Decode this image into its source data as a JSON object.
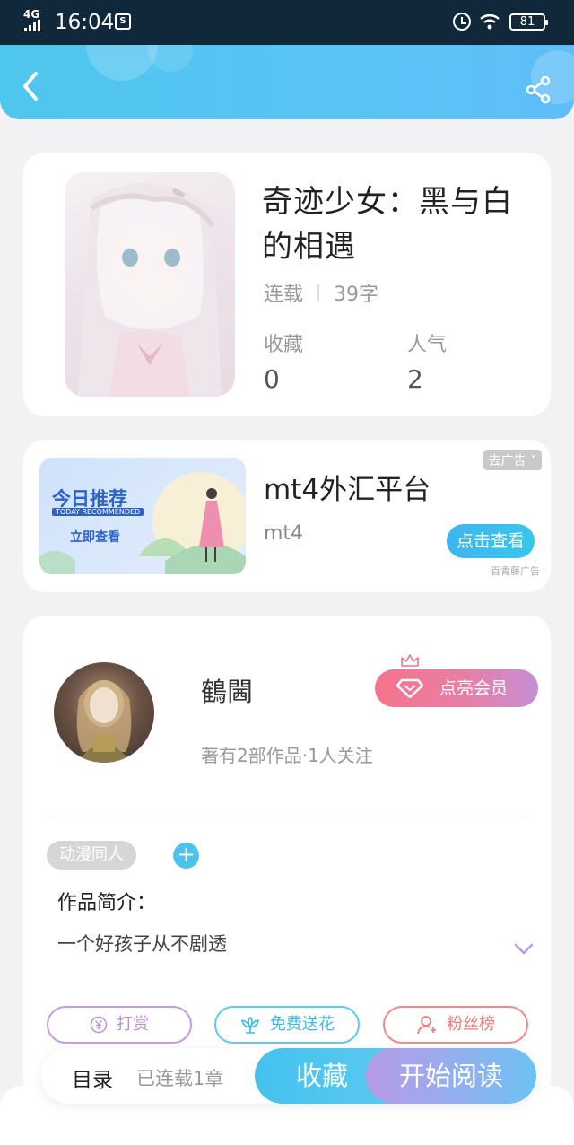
{
  "status_bar": {
    "network": "4G",
    "time": "16:04",
    "extra_icon": "S",
    "battery": "81"
  },
  "header": {
    "back_icon": "chevron-left-icon",
    "share_icon": "share-icon"
  },
  "book": {
    "title": "奇迹少女：黑与白的相遇",
    "status": "连载",
    "word_count": "39字",
    "favorites_label": "收藏",
    "favorites_value": "0",
    "popularity_label": "人气",
    "popularity_value": "2"
  },
  "ad": {
    "remove_label": "去广告",
    "banner_title": "今日推荐",
    "banner_subtitle": "TODAY RECOMMENDED",
    "banner_button": "立即查看",
    "title": "mt4外汇平台",
    "subtitle": "mt4",
    "button": "点击查看",
    "source": "百青藤广告"
  },
  "author": {
    "name": "鶴閪",
    "stats": "著有2部作品·1人关注",
    "vip_button": "点亮会员"
  },
  "tags": [
    "动漫同人"
  ],
  "intro": {
    "label": "作品简介：",
    "text": "一个好孩子从不剧透"
  },
  "actions": [
    {
      "label": "打赏",
      "icon": "yen-icon",
      "color": "#b98ee0"
    },
    {
      "label": "免费送花",
      "icon": "flower-icon",
      "color": "#4fc4ec"
    },
    {
      "label": "粉丝榜",
      "icon": "user-icon",
      "color": "#ee7b7b"
    }
  ],
  "bottom_bar": {
    "toc_label": "目录",
    "toc_count": "已连载1章",
    "favorite_button": "收藏",
    "read_button": "开始阅读"
  }
}
